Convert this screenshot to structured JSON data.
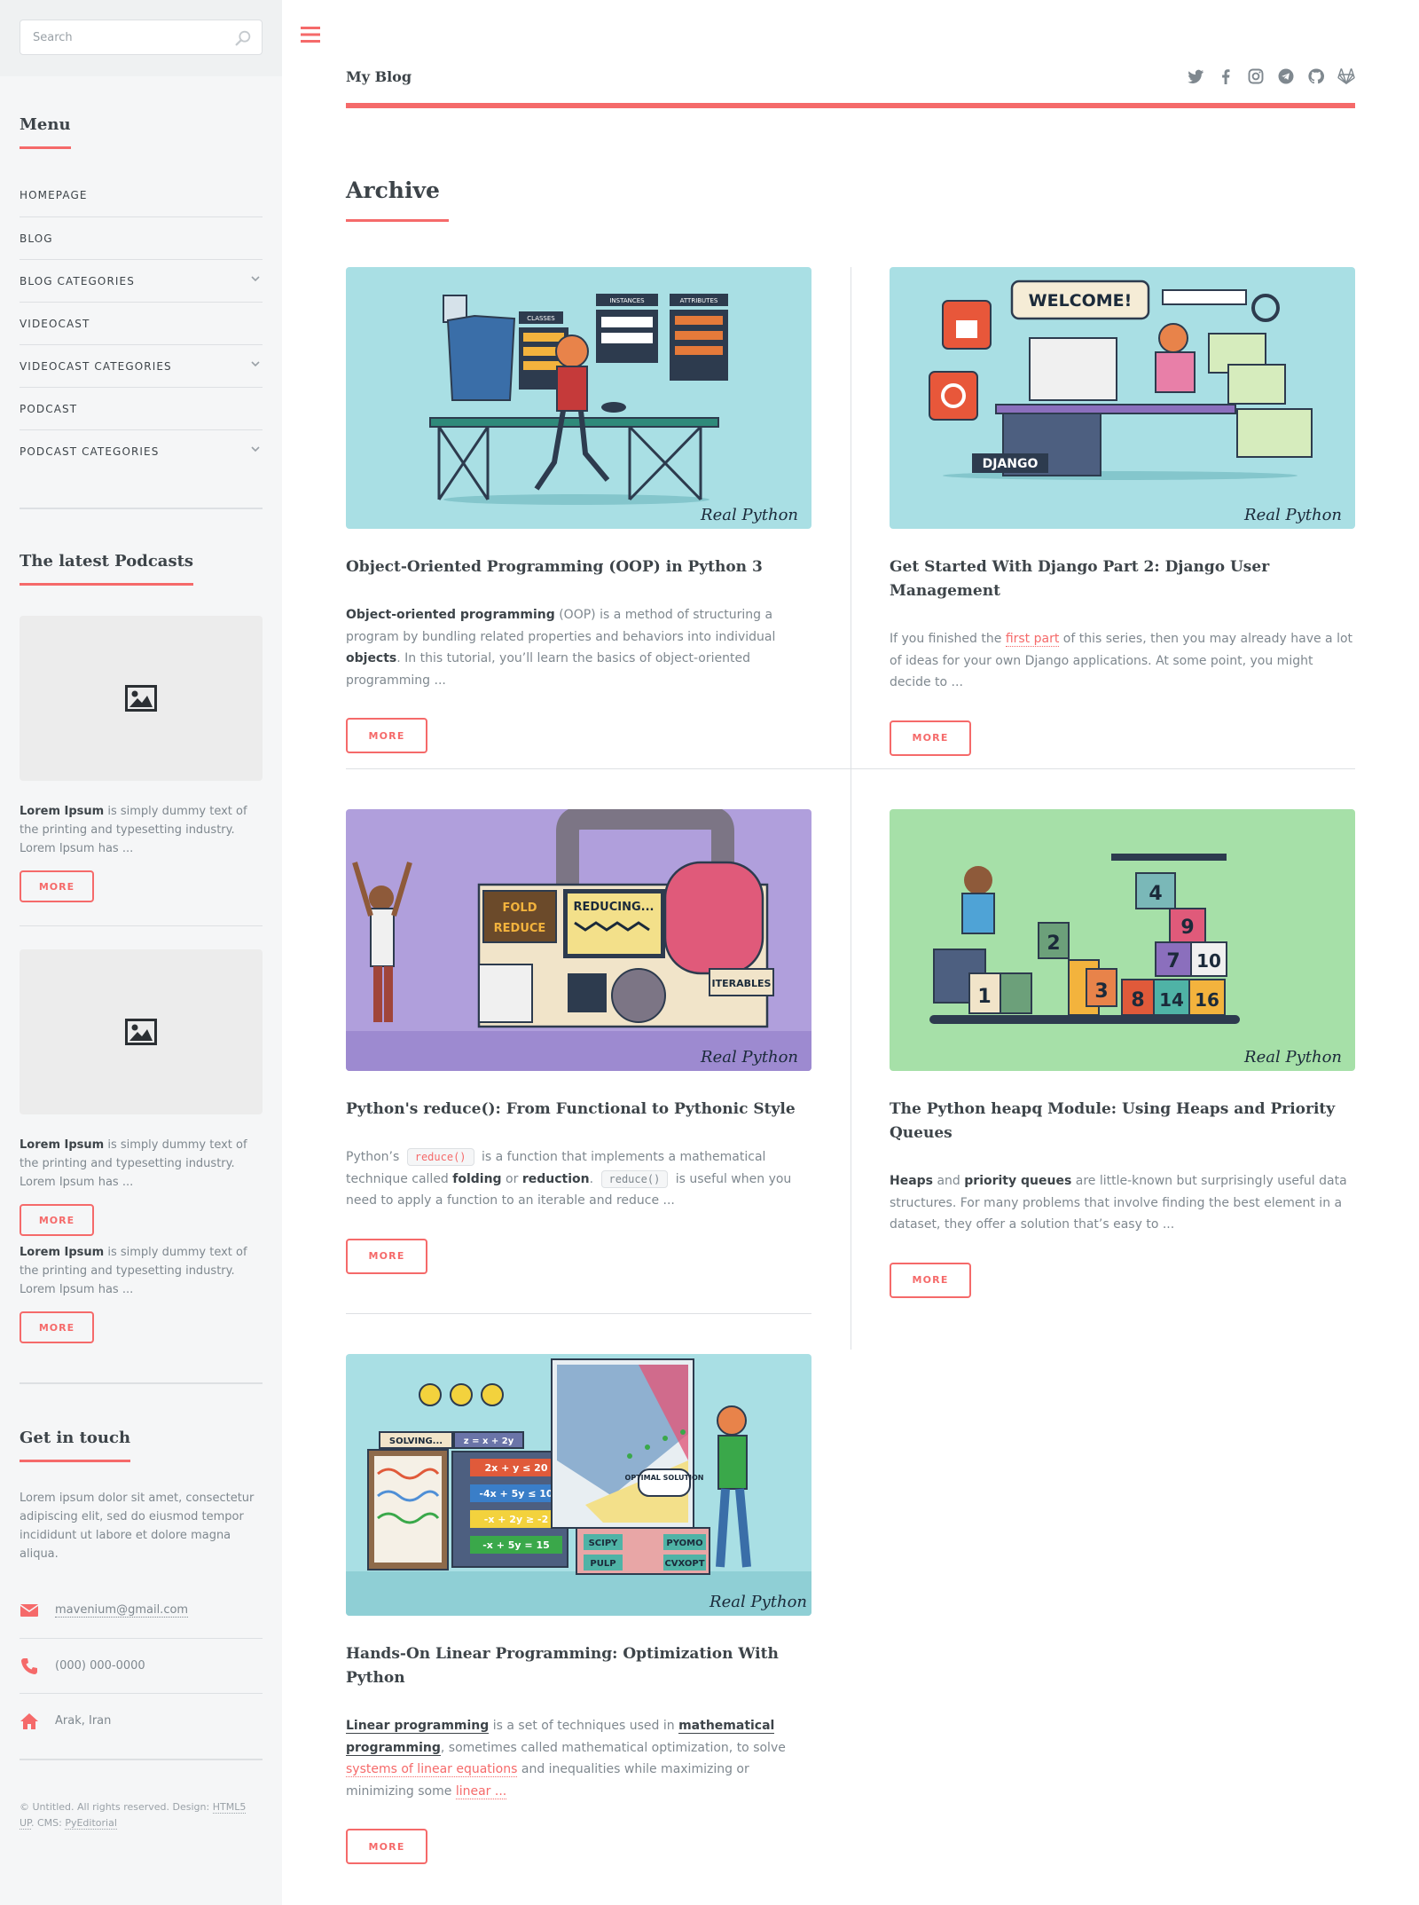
{
  "sidebar": {
    "search_placeholder": "Search",
    "menu": {
      "heading": "Menu",
      "items": [
        {
          "label": "HOMEPAGE",
          "has_submenu": false
        },
        {
          "label": "BLOG",
          "has_submenu": false
        },
        {
          "label": "BLOG CATEGORIES",
          "has_submenu": true
        },
        {
          "label": "VIDEOCAST",
          "has_submenu": false
        },
        {
          "label": "VIDEOCAST CATEGORIES",
          "has_submenu": true
        },
        {
          "label": "PODCAST",
          "has_submenu": false
        },
        {
          "label": "PODCAST CATEGORIES",
          "has_submenu": true
        }
      ]
    },
    "podcasts": {
      "heading": "The latest Podcasts",
      "items": [
        {
          "bold": "Lorem Ipsum",
          "text": " is simply dummy text of the printing and typesetting industry. Lorem Ipsum has ...",
          "button": "MORE"
        },
        {
          "bold": "Lorem Ipsum",
          "text": " is simply dummy text of the printing and typesetting industry. Lorem Ipsum has ...",
          "button": "MORE"
        },
        {
          "bold": "Lorem Ipsum",
          "text": " is simply dummy text of the printing and typesetting industry. Lorem Ipsum has ...",
          "button": "MORE"
        }
      ]
    },
    "contact": {
      "heading": "Get in touch",
      "text": "Lorem ipsum dolor sit amet, consectetur adipiscing elit, sed do eiusmod tempor incididunt ut labore et dolore magna aliqua.",
      "email": "mavenium@gmail.com",
      "phone": "(000) 000-0000",
      "address": "Arak, Iran"
    },
    "footer": {
      "prefix": "© Untitled. All rights reserved. Design: ",
      "design_link": "HTML5 UP",
      "cms_prefix": ". CMS: ",
      "cms_link": "PyEditorial"
    }
  },
  "header": {
    "logo": "My Blog",
    "socials": [
      "twitter-icon",
      "facebook-icon",
      "instagram-icon",
      "telegram-icon",
      "github-icon",
      "gitlab-icon"
    ]
  },
  "main": {
    "title": "Archive",
    "posts": [
      {
        "title": "Object-Oriented Programming (OOP) in Python 3",
        "excerpt": {
          "b1": "Object-oriented programming",
          "t1": " (OOP) is a method of structuring a program by bundling related properties and behaviors into individual ",
          "b2": "objects",
          "t2": ". In this tutorial, you’ll learn the basics of object-oriented programming ..."
        },
        "image_labels": [
          "CLASSES",
          "INSTANCES",
          "ATTRIBUTES"
        ],
        "button": "MORE"
      },
      {
        "title": "Get Started With Django Part 2: Django User Management",
        "excerpt": {
          "t1": "If you finished the ",
          "link": "first part",
          "t2": " of this series, then you may already have a lot of ideas for your own Django applications. At some point, you might decide to ..."
        },
        "image_labels": [
          "WELCOME!",
          "DJANGO"
        ],
        "button": "MORE"
      },
      {
        "title": "Python's reduce(): From Functional to Pythonic Style",
        "excerpt": {
          "t1": "Python’s ",
          "code1": "reduce()",
          "t2": " is a function that implements a mathematical technique called ",
          "b1": "folding",
          "t3": " or ",
          "b2": "reduction",
          "t4": ". ",
          "code2": "reduce()",
          "t5": " is useful when you need to apply a function to an iterable and reduce ..."
        },
        "image_labels": [
          "FOLD",
          "REDUCE",
          "REDUCING...",
          "ITERABLES"
        ],
        "button": "MORE"
      },
      {
        "title": "The Python heapq Module: Using Heaps and Priority Queues",
        "excerpt": {
          "b1": "Heaps",
          "t1": " and ",
          "b2": "priority queues",
          "t2": " are little-known but surprisingly useful data structures. For many problems that involve finding the best element in a dataset, they offer a solution that’s easy to ..."
        },
        "image_labels": [
          "4",
          "2",
          "9",
          "1",
          "3",
          "7",
          "10",
          "8",
          "14",
          "16"
        ],
        "button": "MORE"
      },
      {
        "title": "Hands-On Linear Programming: Optimization With Python",
        "excerpt": {
          "l1": "Linear programming",
          "t1": " is a set of techniques used in ",
          "l2": "mathematical programming",
          "t2": ", sometimes called mathematical optimization, to solve ",
          "l3": "systems of linear equations",
          "t3": " and inequalities while maximizing or minimizing some ",
          "l4": "linear ..."
        },
        "image_labels": [
          "SOLVING...",
          "z = x + 2y",
          "2x + y ≤ 20",
          "-4x + 5y ≤ 10",
          "-x + 2y ≥ -2",
          "-x + 5y = 15",
          "OPTIMAL SOLUTION",
          "SCIPY",
          "PYOMO",
          "PULP",
          "CVXOPT"
        ],
        "button": "MORE"
      }
    ],
    "image_credit": "Real Python"
  },
  "colors": {
    "accent": "#f56a6a",
    "heading": "#3d4449",
    "body": "#7f888f",
    "sidebar_bg": "#f5f6f7",
    "border": "#dde0e3"
  }
}
